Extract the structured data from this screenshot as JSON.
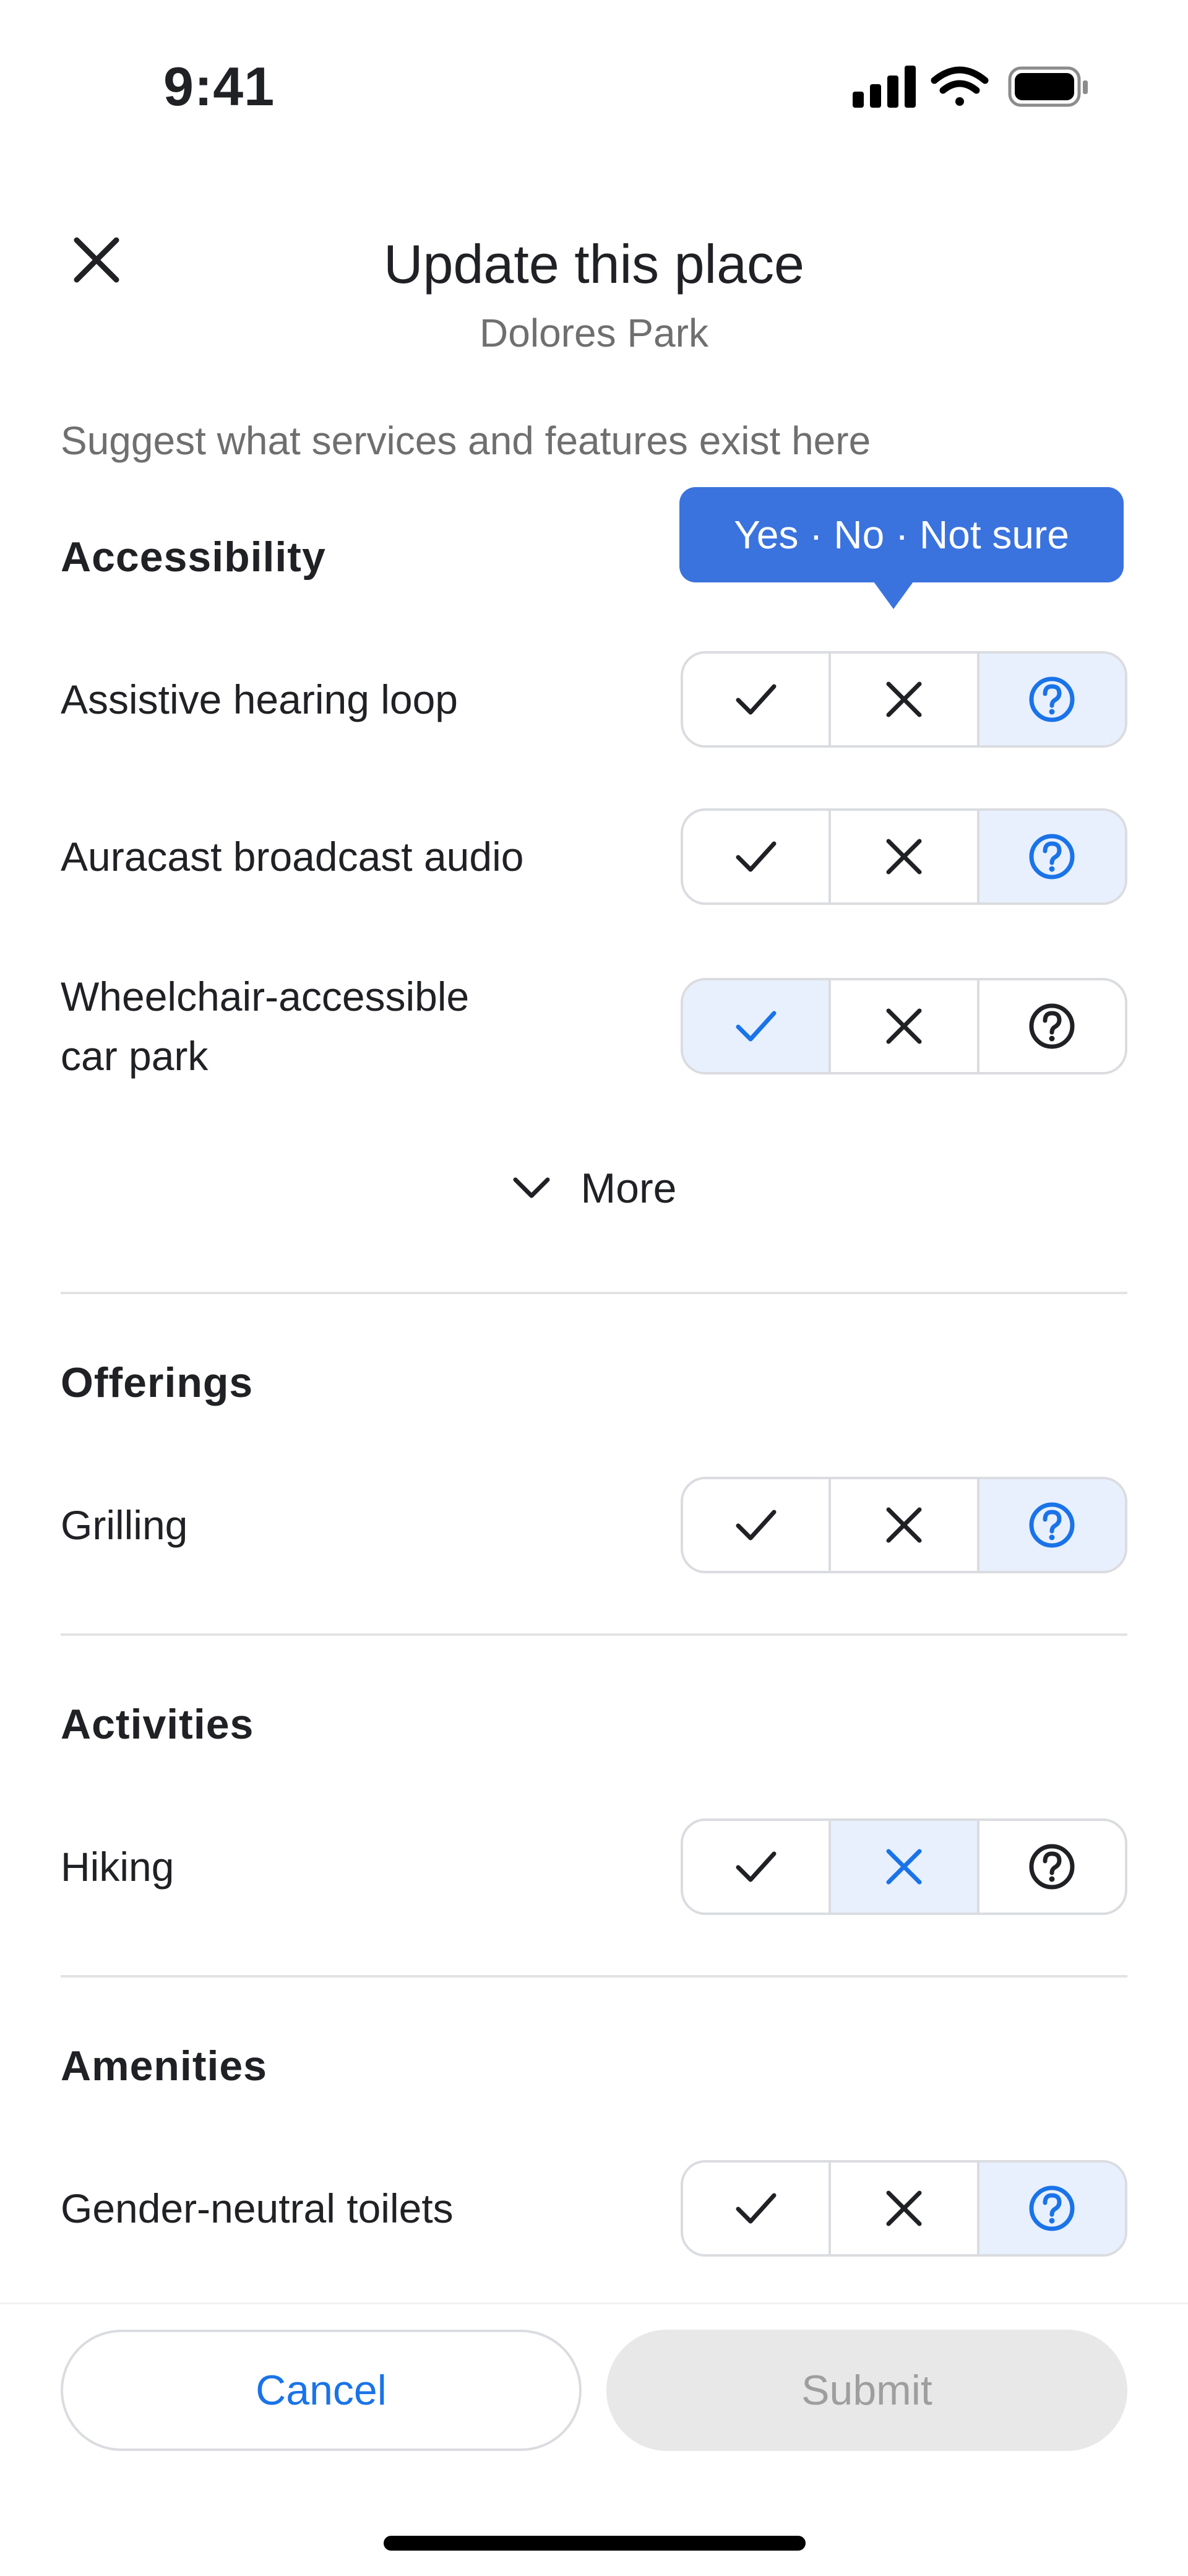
{
  "status_bar": {
    "time": "9:41"
  },
  "header": {
    "title": "Update this place",
    "subtitle": "Dolores Park",
    "intro": "Suggest what services and features exist here"
  },
  "tooltip": {
    "text": "Yes · No · Not sure"
  },
  "sections": {
    "accessibility": {
      "title": "Accessibility",
      "rows": [
        {
          "label": "Assistive hearing loop",
          "selected": "not_sure"
        },
        {
          "label": "Auracast broadcast audio",
          "selected": "not_sure"
        },
        {
          "label_line1": "Wheelchair-accessible",
          "label_line2": "car park",
          "selected": "yes"
        }
      ],
      "more_label": "More"
    },
    "offerings": {
      "title": "Offerings",
      "rows": [
        {
          "label": "Grilling",
          "selected": "not_sure"
        }
      ]
    },
    "activities": {
      "title": "Activities",
      "rows": [
        {
          "label": "Hiking",
          "selected": "no"
        }
      ]
    },
    "amenities": {
      "title": "Amenities",
      "rows": [
        {
          "label": "Gender-neutral toilets",
          "selected": "not_sure"
        }
      ]
    }
  },
  "actions": {
    "cancel": "Cancel",
    "submit": "Submit"
  },
  "colors": {
    "accent": "#1a73e8",
    "selected_bg": "#e8f0fe",
    "tooltip_bg": "#3a73de",
    "icon_default": "#202124"
  },
  "icons": {
    "close": "close-icon",
    "yes": "check-icon",
    "no": "x-icon",
    "not_sure": "question-circle-icon",
    "more": "chevron-down-icon"
  }
}
